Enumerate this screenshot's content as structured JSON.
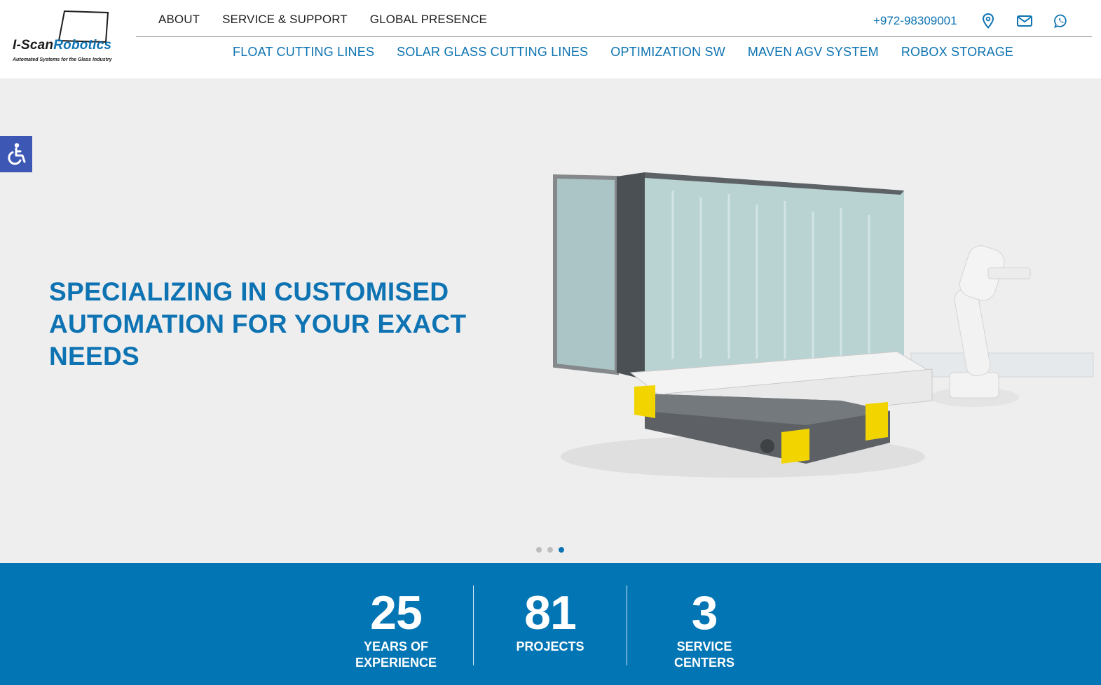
{
  "brand": {
    "name_part1": "I-Scan",
    "name_part2": "Robotics",
    "tagline": "Automated Systems for the Glass Industry"
  },
  "top_nav": [
    {
      "label": "ABOUT"
    },
    {
      "label": "SERVICE & SUPPORT"
    },
    {
      "label": "GLOBAL PRESENCE"
    }
  ],
  "contact": {
    "phone": "+972-98309001",
    "icons": [
      "map-pin-icon",
      "envelope-icon",
      "whatsapp-icon"
    ]
  },
  "main_nav": [
    {
      "label": "FLOAT CUTTING LINES"
    },
    {
      "label": "SOLAR GLASS CUTTING LINES"
    },
    {
      "label": "OPTIMIZATION SW"
    },
    {
      "label": "MAVEN AGV SYSTEM"
    },
    {
      "label": "ROBOX STORAGE"
    }
  ],
  "hero": {
    "title": "SPECIALIZING IN CUSTOMISED AUTOMATION FOR YOUR EXACT NEEDS",
    "slides_total": 3,
    "active_slide": 3
  },
  "accessibility": {
    "icon": "wheelchair-icon"
  },
  "stats": [
    {
      "number": "25",
      "label": "YEARS OF\nEXPERIENCE"
    },
    {
      "number": "81",
      "label": "PROJECTS"
    },
    {
      "number": "3",
      "label": "SERVICE\nCENTERS"
    }
  ],
  "colors": {
    "brand_blue": "#0d73b2",
    "stats_bg": "#0275b4",
    "hero_bg": "#eeeeee",
    "access_btn": "#3d57b5",
    "agv_yellow": "#f2d500"
  }
}
